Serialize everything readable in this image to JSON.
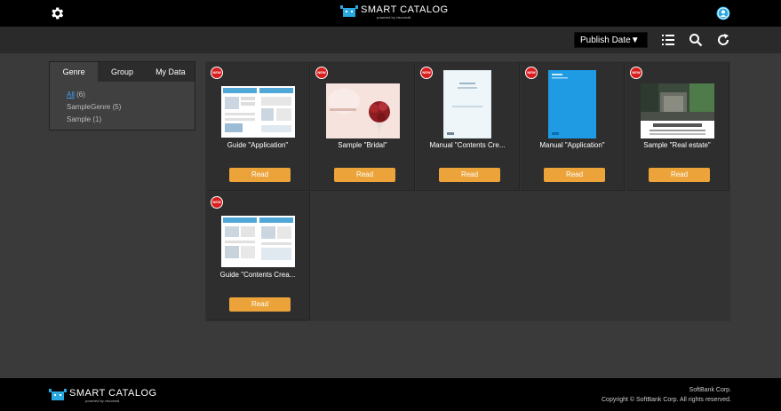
{
  "header": {
    "brand_name": "SMART CATALOG",
    "brand_sub": "powered by viscomall",
    "settings_icon": "gear-icon",
    "user_icon": "user-icon"
  },
  "toolbar": {
    "sort_label": "Publish Date▼",
    "icons": [
      "list-icon",
      "search-icon",
      "refresh-icon"
    ]
  },
  "sidebar": {
    "tabs": [
      {
        "label": "Genre"
      },
      {
        "label": "Group"
      },
      {
        "label": "My Data"
      }
    ],
    "genres": [
      {
        "name": "All",
        "count": "(6)"
      },
      {
        "name": "SampleGenre",
        "count": "(5)"
      },
      {
        "name": "Sample",
        "count": "(1)"
      }
    ]
  },
  "catalogs": [
    {
      "badge": "NEW",
      "title": "Guide \"Application\"",
      "read": "Read",
      "thumb": "guide"
    },
    {
      "badge": "NEW",
      "title": "Sample \"Bridal\"",
      "read": "Read",
      "thumb": "bridal"
    },
    {
      "badge": "NEW",
      "title": "Manual \"Contents Cre...",
      "read": "Read",
      "thumb": "manual-white"
    },
    {
      "badge": "NEW",
      "title": "Manual \"Application\"",
      "read": "Read",
      "thumb": "manual-blue"
    },
    {
      "badge": "NEW",
      "title": "Sample \"Real estate\"",
      "read": "Read",
      "thumb": "realestate"
    },
    {
      "badge": "NEW",
      "title": "Guide \"Contents Crea...",
      "read": "Read",
      "thumb": "guide"
    }
  ],
  "footer": {
    "brand_name": "SMART CATALOG",
    "brand_sub": "powered by viscomall",
    "company": "SoftBank Corp.",
    "copyright": "Copyright © SoftBank Corp. All rights reserved."
  },
  "colors": {
    "accent_button": "#eba33a",
    "badge_red": "#d81e1e",
    "link_blue": "#3aa0ff",
    "brand_cyan": "#2aa8e0"
  }
}
